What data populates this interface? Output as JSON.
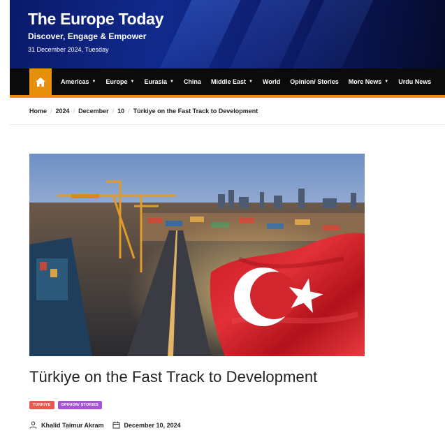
{
  "site": {
    "title": "The Europe Today",
    "tagline": "Discover, Engage & Empower",
    "date": "31 December 2024, Tuesday"
  },
  "nav": {
    "items": [
      {
        "label": "Americas",
        "has_dropdown": true
      },
      {
        "label": "Europe",
        "has_dropdown": true
      },
      {
        "label": "Eurasia",
        "has_dropdown": true
      },
      {
        "label": "China",
        "has_dropdown": false
      },
      {
        "label": "Middle East",
        "has_dropdown": true
      },
      {
        "label": "World",
        "has_dropdown": false
      },
      {
        "label": "Opinion/ Stories",
        "has_dropdown": false
      },
      {
        "label": "More News",
        "has_dropdown": true
      },
      {
        "label": "Urdu News",
        "has_dropdown": false
      }
    ],
    "accent_color": "#e8900c"
  },
  "breadcrumb": [
    "Home",
    "2024",
    "December",
    "10",
    "Türkiye on the Fast Track to Development"
  ],
  "article": {
    "title": "Türkiye on the Fast Track to Development",
    "tags": [
      "Turkiye",
      "Opinion/ Stories"
    ],
    "author": "Khalid Taimur Akram",
    "date": "December 10, 2024"
  },
  "icons": {
    "home": "home-icon",
    "user": "user-icon",
    "calendar": "calendar-icon",
    "caret": "caret-down-icon"
  }
}
